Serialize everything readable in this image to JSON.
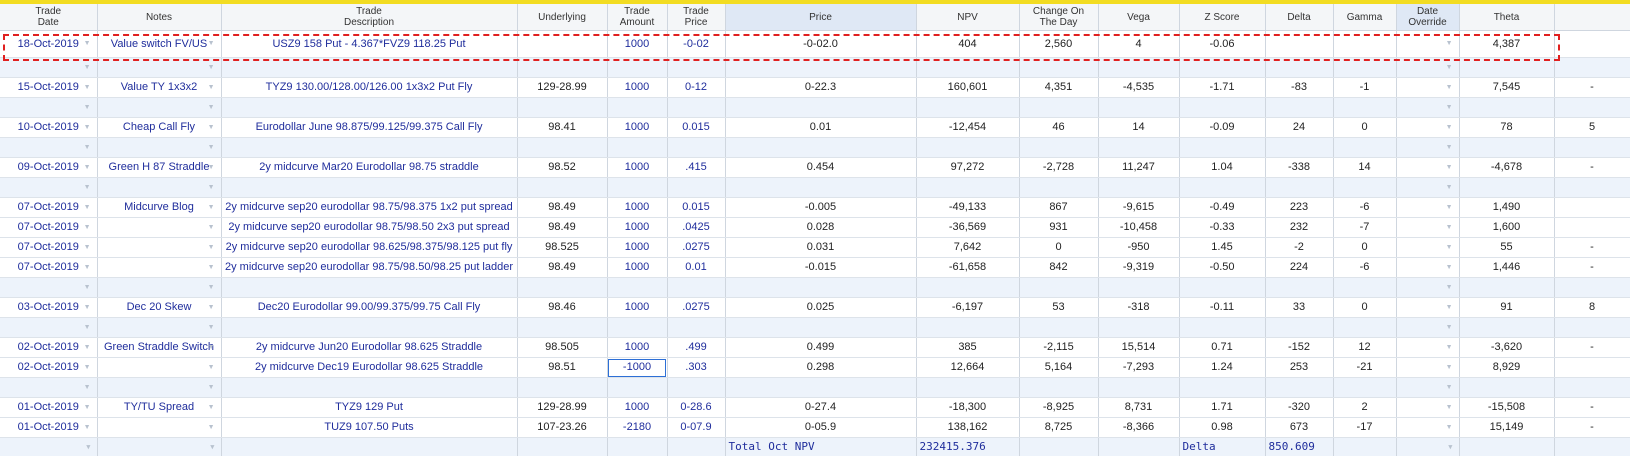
{
  "columns": [
    {
      "l1": "Trade",
      "l2": "Date"
    },
    {
      "l1": "Notes",
      "l2": ""
    },
    {
      "l1": "Trade",
      "l2": "Description"
    },
    {
      "l1": "Underlying",
      "l2": ""
    },
    {
      "l1": "Trade",
      "l2": "Amount"
    },
    {
      "l1": "Trade",
      "l2": "Price"
    },
    {
      "l1": "Price",
      "l2": ""
    },
    {
      "l1": "NPV",
      "l2": ""
    },
    {
      "l1": "Change On",
      "l2": "The Day"
    },
    {
      "l1": "Vega",
      "l2": ""
    },
    {
      "l1": "Z Score",
      "l2": ""
    },
    {
      "l1": "Delta",
      "l2": ""
    },
    {
      "l1": "Gamma",
      "l2": ""
    },
    {
      "l1": "Date",
      "l2": "Override"
    },
    {
      "l1": "Theta",
      "l2": ""
    },
    {
      "l1": "",
      "l2": ""
    }
  ],
  "dropdown_glyph": "▼",
  "rows": [
    {
      "date": "18-Oct-2019",
      "notes": "Value switch FV/US",
      "desc": "USZ9 158 Put - 4.367*FVZ9 118.25 Put",
      "underlying": "",
      "amount": "1000",
      "tprice": "-0-02",
      "price": "-0-02.0",
      "npv": "404",
      "change": "2,560",
      "vega": "4",
      "z": "-0.06",
      "delta": "",
      "gamma": "",
      "theta": "4,387",
      "extra": ""
    },
    {
      "date": "15-Oct-2019",
      "notes": "Value TY 1x3x2",
      "desc": "TYZ9 130.00/128.00/126.00 1x3x2 Put Fly",
      "underlying": "129-28.99",
      "amount": "1000",
      "tprice": "0-12",
      "price": "0-22.3",
      "npv": "160,601",
      "change": "4,351",
      "vega": "-4,535",
      "z": "-1.71",
      "delta": "-83",
      "gamma": "-1",
      "theta": "7,545",
      "extra": "-"
    },
    {
      "date": "10-Oct-2019",
      "notes": "Cheap Call Fly",
      "desc": "Eurodollar June 98.875/99.125/99.375 Call Fly",
      "underlying": "98.41",
      "amount": "1000",
      "tprice": "0.015",
      "price": "0.01",
      "npv": "-12,454",
      "change": "46",
      "vega": "14",
      "z": "-0.09",
      "delta": "24",
      "gamma": "0",
      "theta": "78",
      "extra": "5"
    },
    {
      "date": "09-Oct-2019",
      "notes": "Green H 87 Straddle",
      "desc": "2y midcurve Mar20 Eurodollar 98.75 straddle",
      "underlying": "98.52",
      "amount": "1000",
      "tprice": ".415",
      "price": "0.454",
      "npv": "97,272",
      "change": "-2,728",
      "vega": "11,247",
      "z": "1.04",
      "delta": "-338",
      "gamma": "14",
      "theta": "-4,678",
      "extra": "-"
    },
    {
      "date": "07-Oct-2019",
      "notes": "Midcurve Blog",
      "desc": "2y midcurve sep20 eurodollar 98.75/98.375 1x2 put spread",
      "underlying": "98.49",
      "amount": "1000",
      "tprice": "0.015",
      "price": "-0.005",
      "npv": "-49,133",
      "change": "867",
      "vega": "-9,615",
      "z": "-0.49",
      "delta": "223",
      "gamma": "-6",
      "theta": "1,490",
      "extra": ""
    },
    {
      "date": "07-Oct-2019",
      "notes": "",
      "desc": "2y midcurve sep20 eurodollar 98.75/98.50 2x3 put spread",
      "underlying": "98.49",
      "amount": "1000",
      "tprice": ".0425",
      "price": "0.028",
      "npv": "-36,569",
      "change": "931",
      "vega": "-10,458",
      "z": "-0.33",
      "delta": "232",
      "gamma": "-7",
      "theta": "1,600",
      "extra": ""
    },
    {
      "date": "07-Oct-2019",
      "notes": "",
      "desc": "2y midcurve sep20 eurodollar 98.625/98.375/98.125 put fly",
      "underlying": "98.525",
      "amount": "1000",
      "tprice": ".0275",
      "price": "0.031",
      "npv": "7,642",
      "change": "0",
      "vega": "-950",
      "z": "1.45",
      "delta": "-2",
      "gamma": "0",
      "theta": "55",
      "extra": "-"
    },
    {
      "date": "07-Oct-2019",
      "notes": "",
      "desc": "2y midcurve sep20 eurodollar 98.75/98.50/98.25 put ladder",
      "underlying": "98.49",
      "amount": "1000",
      "tprice": "0.01",
      "price": "-0.015",
      "npv": "-61,658",
      "change": "842",
      "vega": "-9,319",
      "z": "-0.50",
      "delta": "224",
      "gamma": "-6",
      "theta": "1,446",
      "extra": "-"
    },
    {
      "date": "03-Oct-2019",
      "notes": "Dec 20 Skew",
      "desc": "Dec20 Eurodollar 99.00/99.375/99.75 Call Fly",
      "underlying": "98.46",
      "amount": "1000",
      "tprice": ".0275",
      "price": "0.025",
      "npv": "-6,197",
      "change": "53",
      "vega": "-318",
      "z": "-0.11",
      "delta": "33",
      "gamma": "0",
      "theta": "91",
      "extra": "8"
    },
    {
      "date": "02-Oct-2019",
      "notes": "Green Straddle Switch",
      "desc": "2y midcurve Jun20 Eurodollar 98.625 Straddle",
      "underlying": "98.505",
      "amount": "1000",
      "tprice": ".499",
      "price": "0.499",
      "npv": "385",
      "change": "-2,115",
      "vega": "15,514",
      "z": "0.71",
      "delta": "-152",
      "gamma": "12",
      "theta": "-3,620",
      "extra": "-"
    },
    {
      "date": "02-Oct-2019",
      "notes": "",
      "desc": "2y midcurve Dec19 Eurodollar 98.625 Straddle",
      "underlying": "98.51",
      "amount": "-1000",
      "tprice": ".303",
      "price": "0.298",
      "npv": "12,664",
      "change": "5,164",
      "vega": "-7,293",
      "z": "1.24",
      "delta": "253",
      "gamma": "-21",
      "theta": "8,929",
      "extra": ""
    },
    {
      "date": "01-Oct-2019",
      "notes": "TY/TU Spread",
      "desc": "TYZ9 129 Put",
      "underlying": "129-28.99",
      "amount": "1000",
      "tprice": "0-28.6",
      "price": "0-27.4",
      "npv": "-18,300",
      "change": "-8,925",
      "vega": "8,731",
      "z": "1.71",
      "delta": "-320",
      "gamma": "2",
      "theta": "-15,508",
      "extra": "-"
    },
    {
      "date": "01-Oct-2019",
      "notes": "",
      "desc": "TUZ9 107.50 Puts",
      "underlying": "107-23.26",
      "amount": "-2180",
      "tprice": "0-07.9",
      "price": "0-05.9",
      "npv": "138,162",
      "change": "8,725",
      "vega": "-8,366",
      "z": "0.98",
      "delta": "673",
      "gamma": "-17",
      "theta": "15,149",
      "extra": "-"
    }
  ],
  "totals": {
    "npv_label": "Total Oct NPV",
    "npv_value": "232415.376",
    "delta_label": "Delta",
    "delta_value": "850.609"
  }
}
